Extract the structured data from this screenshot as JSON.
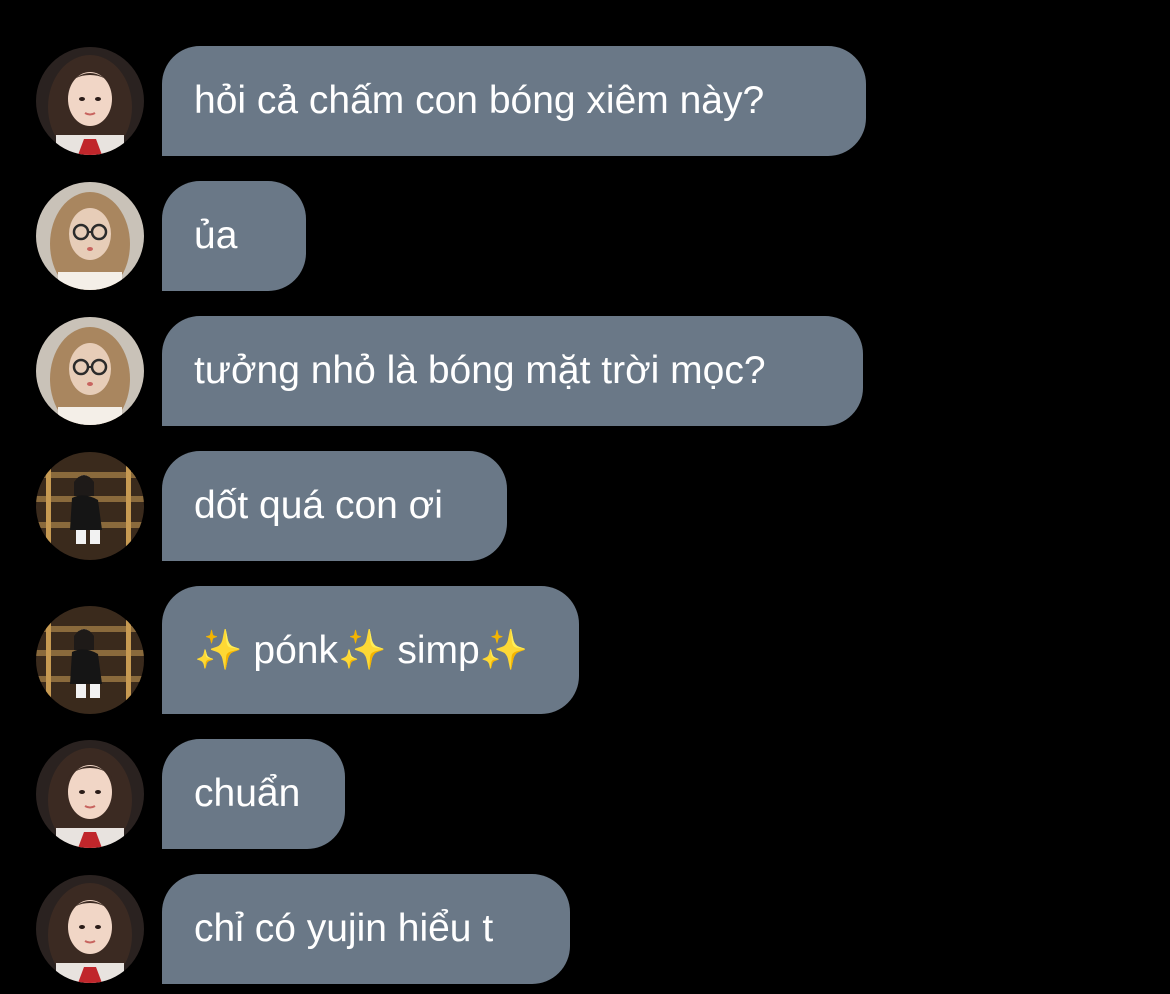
{
  "messages": [
    {
      "text": "hỏi cả chấm con bóng xiêm này?",
      "avatar": "profile-photo-long-dark-hair"
    },
    {
      "text": "ủa",
      "avatar": "profile-photo-glasses"
    },
    {
      "text": "tưởng nhỏ là bóng mặt trời mọc?",
      "avatar": "profile-photo-glasses"
    },
    {
      "text": "dốt quá con ơi",
      "avatar": "profile-photo-sitting-stairs"
    },
    {
      "text": "✨ pónk✨ simp✨",
      "avatar": "profile-photo-sitting-stairs"
    },
    {
      "text": "chuẩn",
      "avatar": "profile-photo-long-dark-hair"
    },
    {
      "text": "chỉ có yujin hiểu t",
      "avatar": "profile-photo-long-dark-hair"
    }
  ],
  "colors": {
    "background": "#000000",
    "bubble": "#6a7887",
    "text": "#ffffff"
  }
}
